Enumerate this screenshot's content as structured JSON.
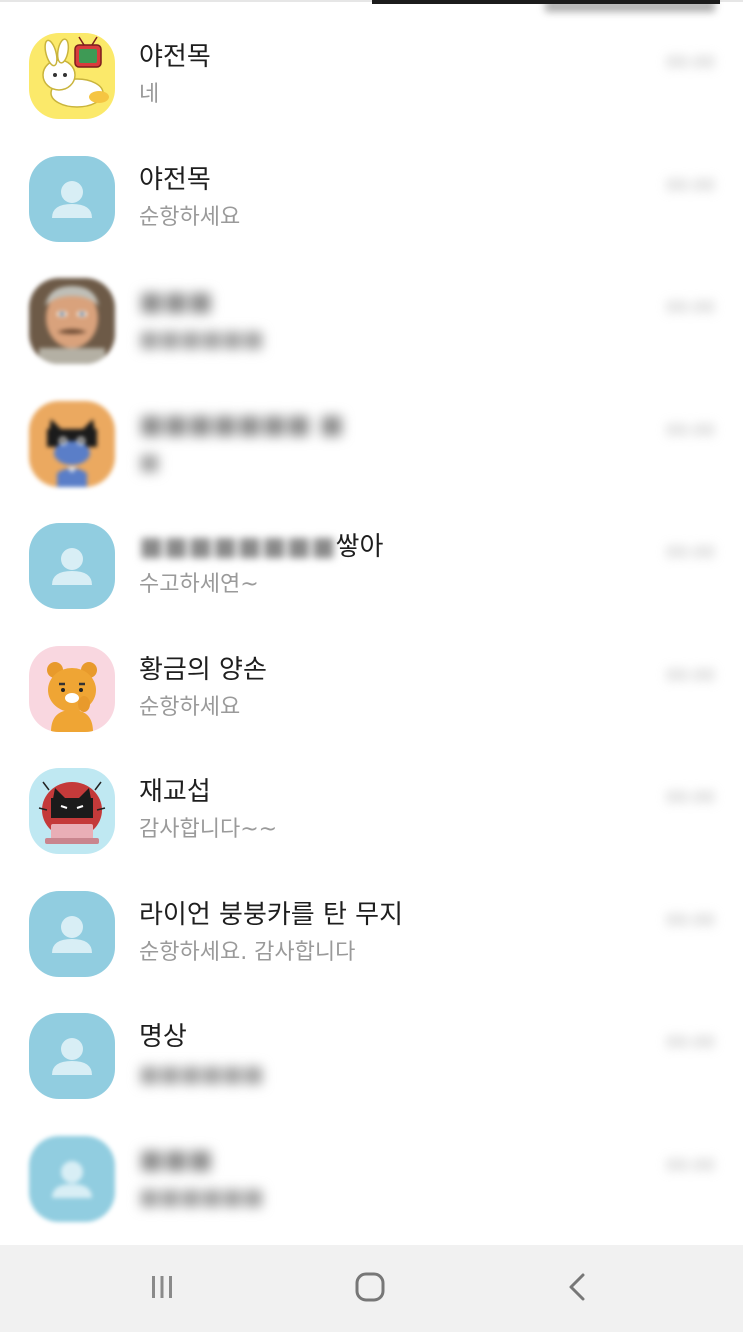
{
  "chats": [
    {
      "name": "야전목",
      "message": "네",
      "time": "",
      "avatar": "bunny-tv-avatar",
      "name_blur": false,
      "msg_blur": false
    },
    {
      "name": "야전목",
      "message": "순항하세요",
      "time": "",
      "avatar": "default-person-avatar",
      "name_blur": false,
      "msg_blur": false
    },
    {
      "name": "",
      "message": "",
      "time": "",
      "avatar": "portrait-avatar",
      "name_blur": true,
      "msg_blur": true
    },
    {
      "name": "",
      "message": "",
      "time": "",
      "avatar": "black-cat-avatar",
      "name_blur": true,
      "msg_blur": true
    },
    {
      "name": "",
      "message": "수고하세연~",
      "time": "",
      "avatar": "default-person-avatar",
      "name_blur": true,
      "msg_blur": false,
      "name_visible_suffix": "쌓아"
    },
    {
      "name": "황금의 양손",
      "message": "순항하세요",
      "time": "",
      "avatar": "ryan-bear-avatar",
      "name_blur": false,
      "msg_blur": false
    },
    {
      "name": "재교섭",
      "message": "감사합니다~~",
      "time": "",
      "avatar": "angry-cat-laptop-avatar",
      "name_blur": false,
      "msg_blur": false
    },
    {
      "name": "라이언 붕붕카를 탄 무지",
      "message": "순항하세요. 감사합니다",
      "time": "",
      "avatar": "default-person-avatar",
      "name_blur": false,
      "msg_blur": false
    },
    {
      "name": "명상",
      "message": "",
      "time": "",
      "avatar": "default-person-avatar",
      "name_blur": false,
      "msg_blur": true
    },
    {
      "name": "",
      "message": "",
      "time": "",
      "avatar": "default-person-avatar",
      "name_blur": true,
      "msg_blur": true
    }
  ],
  "navigation": {
    "recent_icon": "recent-apps-icon",
    "home_icon": "home-icon",
    "back_icon": "back-icon"
  },
  "colors": {
    "default_avatar_bg": "#91cde0",
    "name_text": "#1e1e1e",
    "message_text": "#9a9a9a",
    "nav_bg": "#f1f1f1"
  }
}
